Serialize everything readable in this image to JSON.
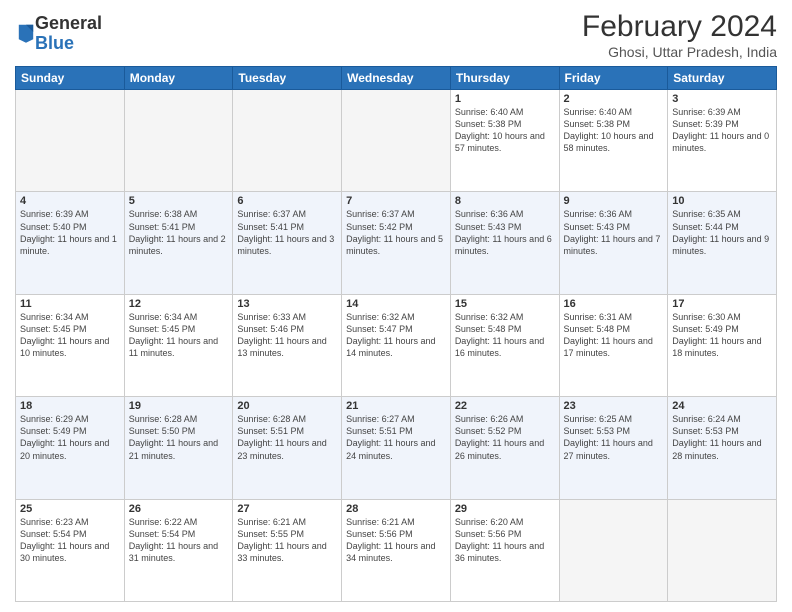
{
  "logo": {
    "general": "General",
    "blue": "Blue"
  },
  "header": {
    "month": "February 2024",
    "location": "Ghosi, Uttar Pradesh, India"
  },
  "weekdays": [
    "Sunday",
    "Monday",
    "Tuesday",
    "Wednesday",
    "Thursday",
    "Friday",
    "Saturday"
  ],
  "weeks": [
    [
      {
        "day": "",
        "empty": true
      },
      {
        "day": "",
        "empty": true
      },
      {
        "day": "",
        "empty": true
      },
      {
        "day": "",
        "empty": true
      },
      {
        "day": "1",
        "sunrise": "6:40 AM",
        "sunset": "5:38 PM",
        "daylight": "10 hours and 57 minutes."
      },
      {
        "day": "2",
        "sunrise": "6:40 AM",
        "sunset": "5:38 PM",
        "daylight": "10 hours and 58 minutes."
      },
      {
        "day": "3",
        "sunrise": "6:39 AM",
        "sunset": "5:39 PM",
        "daylight": "11 hours and 0 minutes."
      }
    ],
    [
      {
        "day": "4",
        "sunrise": "6:39 AM",
        "sunset": "5:40 PM",
        "daylight": "11 hours and 1 minute."
      },
      {
        "day": "5",
        "sunrise": "6:38 AM",
        "sunset": "5:41 PM",
        "daylight": "11 hours and 2 minutes."
      },
      {
        "day": "6",
        "sunrise": "6:37 AM",
        "sunset": "5:41 PM",
        "daylight": "11 hours and 3 minutes."
      },
      {
        "day": "7",
        "sunrise": "6:37 AM",
        "sunset": "5:42 PM",
        "daylight": "11 hours and 5 minutes."
      },
      {
        "day": "8",
        "sunrise": "6:36 AM",
        "sunset": "5:43 PM",
        "daylight": "11 hours and 6 minutes."
      },
      {
        "day": "9",
        "sunrise": "6:36 AM",
        "sunset": "5:43 PM",
        "daylight": "11 hours and 7 minutes."
      },
      {
        "day": "10",
        "sunrise": "6:35 AM",
        "sunset": "5:44 PM",
        "daylight": "11 hours and 9 minutes."
      }
    ],
    [
      {
        "day": "11",
        "sunrise": "6:34 AM",
        "sunset": "5:45 PM",
        "daylight": "11 hours and 10 minutes."
      },
      {
        "day": "12",
        "sunrise": "6:34 AM",
        "sunset": "5:45 PM",
        "daylight": "11 hours and 11 minutes."
      },
      {
        "day": "13",
        "sunrise": "6:33 AM",
        "sunset": "5:46 PM",
        "daylight": "11 hours and 13 minutes."
      },
      {
        "day": "14",
        "sunrise": "6:32 AM",
        "sunset": "5:47 PM",
        "daylight": "11 hours and 14 minutes."
      },
      {
        "day": "15",
        "sunrise": "6:32 AM",
        "sunset": "5:48 PM",
        "daylight": "11 hours and 16 minutes."
      },
      {
        "day": "16",
        "sunrise": "6:31 AM",
        "sunset": "5:48 PM",
        "daylight": "11 hours and 17 minutes."
      },
      {
        "day": "17",
        "sunrise": "6:30 AM",
        "sunset": "5:49 PM",
        "daylight": "11 hours and 18 minutes."
      }
    ],
    [
      {
        "day": "18",
        "sunrise": "6:29 AM",
        "sunset": "5:49 PM",
        "daylight": "11 hours and 20 minutes."
      },
      {
        "day": "19",
        "sunrise": "6:28 AM",
        "sunset": "5:50 PM",
        "daylight": "11 hours and 21 minutes."
      },
      {
        "day": "20",
        "sunrise": "6:28 AM",
        "sunset": "5:51 PM",
        "daylight": "11 hours and 23 minutes."
      },
      {
        "day": "21",
        "sunrise": "6:27 AM",
        "sunset": "5:51 PM",
        "daylight": "11 hours and 24 minutes."
      },
      {
        "day": "22",
        "sunrise": "6:26 AM",
        "sunset": "5:52 PM",
        "daylight": "11 hours and 26 minutes."
      },
      {
        "day": "23",
        "sunrise": "6:25 AM",
        "sunset": "5:53 PM",
        "daylight": "11 hours and 27 minutes."
      },
      {
        "day": "24",
        "sunrise": "6:24 AM",
        "sunset": "5:53 PM",
        "daylight": "11 hours and 28 minutes."
      }
    ],
    [
      {
        "day": "25",
        "sunrise": "6:23 AM",
        "sunset": "5:54 PM",
        "daylight": "11 hours and 30 minutes."
      },
      {
        "day": "26",
        "sunrise": "6:22 AM",
        "sunset": "5:54 PM",
        "daylight": "11 hours and 31 minutes."
      },
      {
        "day": "27",
        "sunrise": "6:21 AM",
        "sunset": "5:55 PM",
        "daylight": "11 hours and 33 minutes."
      },
      {
        "day": "28",
        "sunrise": "6:21 AM",
        "sunset": "5:56 PM",
        "daylight": "11 hours and 34 minutes."
      },
      {
        "day": "29",
        "sunrise": "6:20 AM",
        "sunset": "5:56 PM",
        "daylight": "11 hours and 36 minutes."
      },
      {
        "day": "",
        "empty": true
      },
      {
        "day": "",
        "empty": true
      }
    ]
  ]
}
